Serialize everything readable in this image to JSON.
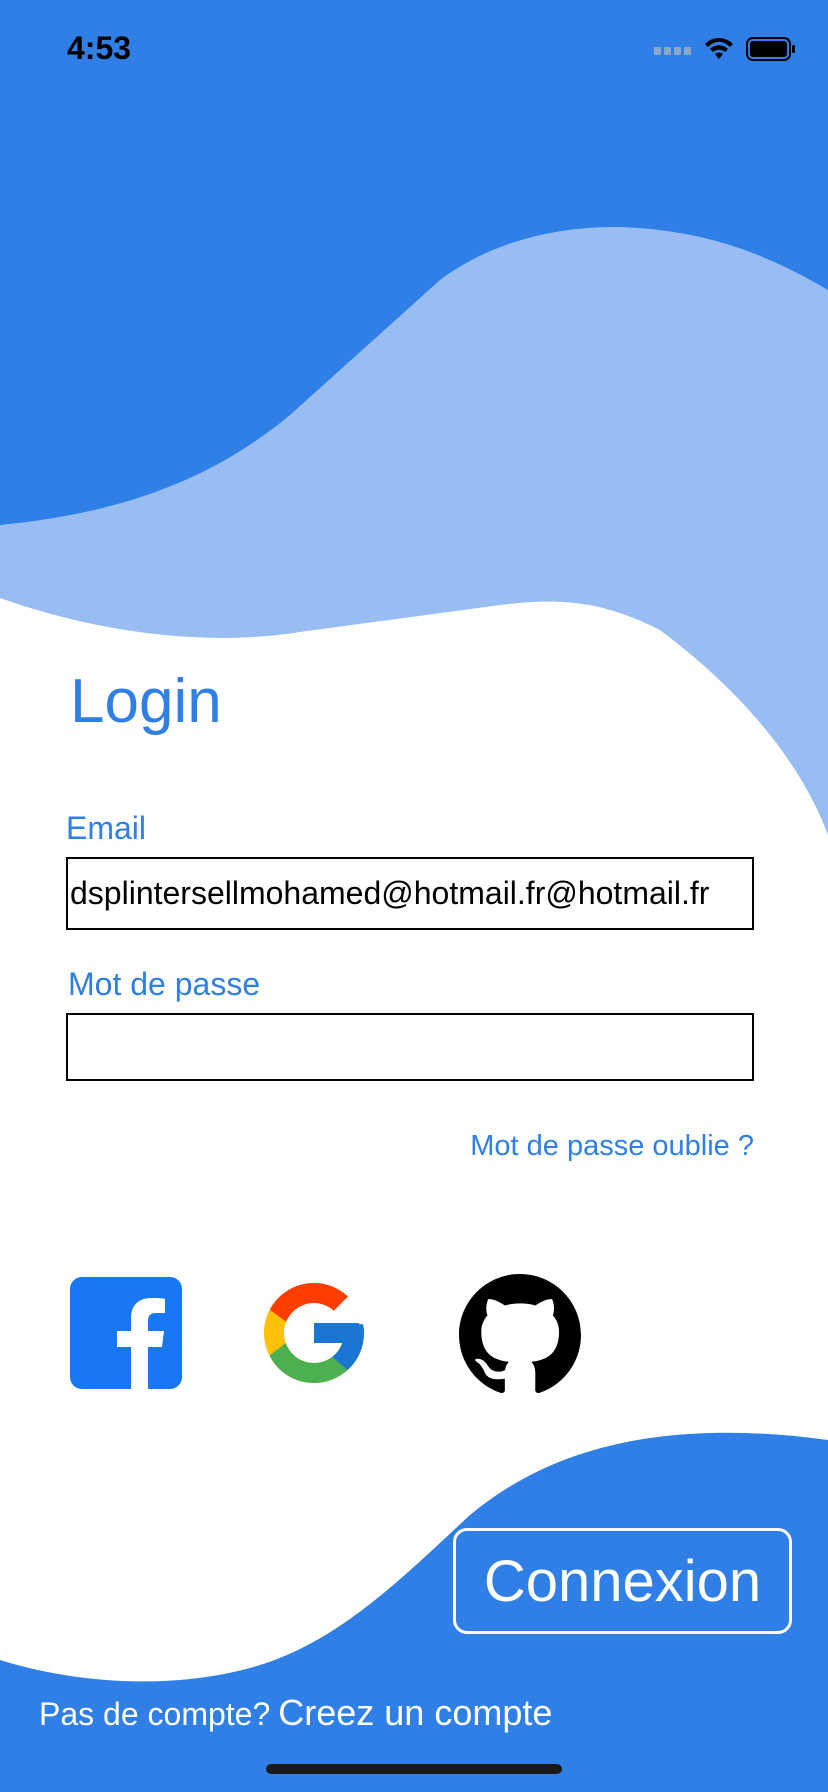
{
  "status_bar": {
    "time": "4:53"
  },
  "login": {
    "title": "Login",
    "email_label": "Email",
    "email_value": "dsplintersellmohamed@hotmail.fr@hotmail.fr",
    "password_label": "Mot de passe",
    "password_value": "",
    "forgot_password": "Mot de passe oublie ?"
  },
  "social": [
    "facebook-icon",
    "google-icon",
    "github-icon"
  ],
  "actions": {
    "connexion": "Connexion"
  },
  "footer": {
    "question": "Pas de compte?",
    "signup": "Creez un compte"
  },
  "colors": {
    "primary": "#2F7FE6",
    "light_wave": "#97BDF3",
    "white": "#FFFFFF"
  }
}
